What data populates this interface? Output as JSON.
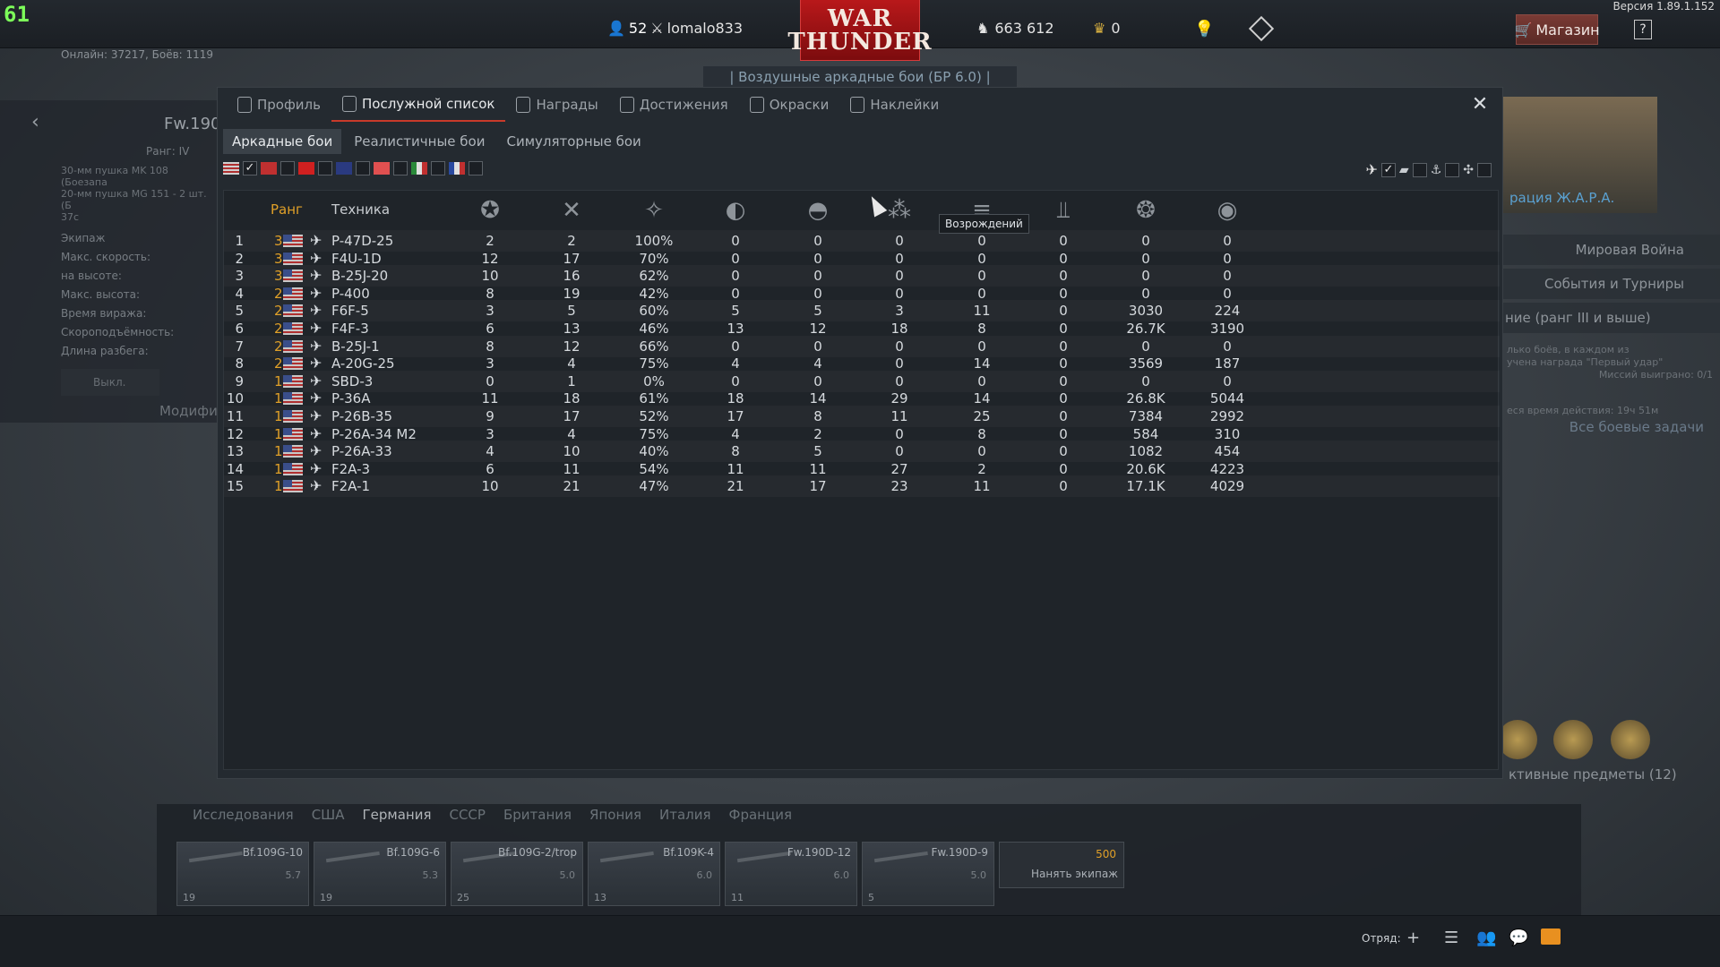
{
  "topbar": {
    "fps": "61",
    "version": "Версия 1.89.1.152",
    "player_level": "52",
    "player_name": "lomalo833",
    "logo_line1": "WAR",
    "logo_line2": "THUNDER",
    "silver_lions": "663 612",
    "golden_eagles": "0",
    "shop_label": "Магазин",
    "help_label": "?"
  },
  "online_text": "Онлайн: 37217, Боёв: 1119",
  "mode_strip": "| Воздушные аркадные бои (БР 6.0) |",
  "vehicle_panel": {
    "title": "Fw.190",
    "rank": "Ранг: IV",
    "armament_1": "30-мм пушка MK 108 (Боезапа",
    "armament_2": "20-мм пушка MG 151 - 2 шт. (Б",
    "armament_3": "37с",
    "stats": [
      "Экипаж",
      "Макс. скорость:",
      "на высоте:",
      "Макс. высота:",
      "Время виража:",
      "Скороподъёмность:",
      "Длина разбега:"
    ],
    "off_button": "Выкл.",
    "mod_label": "Модифи"
  },
  "right_panel": {
    "event_name": "рация Ж.А.Р.А.",
    "world_war": "Мировая Война",
    "events": "События и Турниры",
    "tasks": "ние (ранг III и выше)",
    "task_text_1": "лько боёв, в каждом из",
    "task_text_2": "учена награда \"Первый удар\"",
    "task_text_3": "Миссий выиграно: 0/1",
    "task_time": "еся время действия: 19ч 51м",
    "all_tasks": "Все боевые задачи",
    "active_items": "ктивные предметы (12)"
  },
  "modal": {
    "tabs": [
      {
        "label": "Профиль",
        "icon": "profile-icon"
      },
      {
        "label": "Послужной список",
        "icon": "service-record-icon"
      },
      {
        "label": "Награды",
        "icon": "awards-icon"
      },
      {
        "label": "Достижения",
        "icon": "achievements-icon"
      },
      {
        "label": "Окраски",
        "icon": "skins-icon"
      },
      {
        "label": "Наклейки",
        "icon": "decals-icon"
      }
    ],
    "subtabs": [
      "Аркадные бои",
      "Реалистичные бои",
      "Симуляторные бои"
    ],
    "table": {
      "headers": {
        "rank": "Ранг",
        "vehicle": "Техника"
      },
      "tooltip": "Возрождений",
      "rows": [
        {
          "n": "1",
          "rank": "3",
          "name": "P-47D-25",
          "v": [
            "2",
            "2",
            "100%",
            "0",
            "0",
            "0",
            "0",
            "0",
            "0",
            "0"
          ]
        },
        {
          "n": "2",
          "rank": "3",
          "name": "F4U-1D",
          "v": [
            "12",
            "17",
            "70%",
            "0",
            "0",
            "0",
            "0",
            "0",
            "0",
            "0"
          ]
        },
        {
          "n": "3",
          "rank": "3",
          "name": "B-25J-20",
          "v": [
            "10",
            "16",
            "62%",
            "0",
            "0",
            "0",
            "0",
            "0",
            "0",
            "0"
          ]
        },
        {
          "n": "4",
          "rank": "2",
          "name": "P-400",
          "v": [
            "8",
            "19",
            "42%",
            "0",
            "0",
            "0",
            "0",
            "0",
            "0",
            "0"
          ]
        },
        {
          "n": "5",
          "rank": "2",
          "name": "F6F-5",
          "v": [
            "3",
            "5",
            "60%",
            "5",
            "5",
            "3",
            "11",
            "0",
            "3030",
            "224"
          ]
        },
        {
          "n": "6",
          "rank": "2",
          "name": "F4F-3",
          "v": [
            "6",
            "13",
            "46%",
            "13",
            "12",
            "18",
            "8",
            "0",
            "26.7K",
            "3190"
          ]
        },
        {
          "n": "7",
          "rank": "2",
          "name": "B-25J-1",
          "v": [
            "8",
            "12",
            "66%",
            "0",
            "0",
            "0",
            "0",
            "0",
            "0",
            "0"
          ]
        },
        {
          "n": "8",
          "rank": "2",
          "name": "A-20G-25",
          "v": [
            "3",
            "4",
            "75%",
            "4",
            "4",
            "0",
            "14",
            "0",
            "3569",
            "187"
          ]
        },
        {
          "n": "9",
          "rank": "1",
          "name": "SBD-3",
          "v": [
            "0",
            "1",
            "0%",
            "0",
            "0",
            "0",
            "0",
            "0",
            "0",
            "0"
          ]
        },
        {
          "n": "10",
          "rank": "1",
          "name": "P-36A",
          "v": [
            "11",
            "18",
            "61%",
            "18",
            "14",
            "29",
            "14",
            "0",
            "26.8K",
            "5044"
          ]
        },
        {
          "n": "11",
          "rank": "1",
          "name": "P-26B-35",
          "v": [
            "9",
            "17",
            "52%",
            "17",
            "8",
            "11",
            "25",
            "0",
            "7384",
            "2992"
          ]
        },
        {
          "n": "12",
          "rank": "1",
          "name": "P-26A-34 M2",
          "v": [
            "3",
            "4",
            "75%",
            "4",
            "2",
            "0",
            "8",
            "0",
            "584",
            "310"
          ]
        },
        {
          "n": "13",
          "rank": "1",
          "name": "P-26A-33",
          "v": [
            "4",
            "10",
            "40%",
            "8",
            "5",
            "0",
            "0",
            "0",
            "1082",
            "454"
          ]
        },
        {
          "n": "14",
          "rank": "1",
          "name": "F2A-3",
          "v": [
            "6",
            "11",
            "54%",
            "11",
            "11",
            "27",
            "2",
            "0",
            "20.6K",
            "4223"
          ]
        },
        {
          "n": "15",
          "rank": "1",
          "name": "F2A-1",
          "v": [
            "10",
            "21",
            "47%",
            "21",
            "17",
            "23",
            "11",
            "0",
            "17.1K",
            "4029"
          ]
        }
      ]
    }
  },
  "research": {
    "title": "Исследования",
    "nations": [
      "США",
      "Германия",
      "СССР",
      "Британия",
      "Япония",
      "Италия",
      "Франция"
    ],
    "vehicles": [
      {
        "name": "Bf.109G-10",
        "br": "5.7",
        "count": "19"
      },
      {
        "name": "Bf.109G-6",
        "br": "5.3",
        "count": "19"
      },
      {
        "name": "Bf.109G-2/trop",
        "br": "5.0",
        "count": "25"
      },
      {
        "name": "Bf.109K-4",
        "br": "6.0",
        "count": "13"
      },
      {
        "name": "Fw.190D-12",
        "br": "6.0",
        "count": "11"
      },
      {
        "name": "Fw.190D-9",
        "br": "5.0",
        "count": "5"
      }
    ],
    "hire_crew": "Нанять экипаж",
    "hire_cost": "500"
  },
  "footer": {
    "squad": "Отряд:"
  }
}
